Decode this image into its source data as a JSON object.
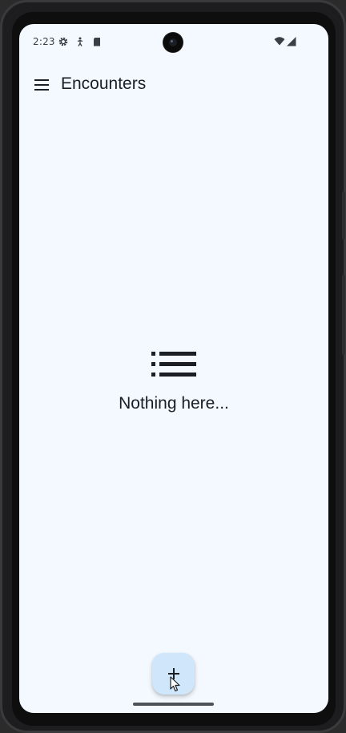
{
  "status_bar": {
    "time": "2:23",
    "left_icons": [
      "settings-gear-icon",
      "accessibility-icon",
      "sd-card-icon"
    ],
    "right_icons": [
      "wifi-icon",
      "cellular-signal-icon"
    ]
  },
  "app_bar": {
    "menu_icon": "hamburger-menu-icon",
    "title": "Encounters"
  },
  "empty_state": {
    "icon": "list-icon",
    "message": "Nothing here..."
  },
  "fab": {
    "icon": "plus-icon",
    "label": "+"
  },
  "colors": {
    "screen_background": "#f3f9fe",
    "fab_background": "#cfe6fb",
    "text_primary": "#1b1f23"
  }
}
